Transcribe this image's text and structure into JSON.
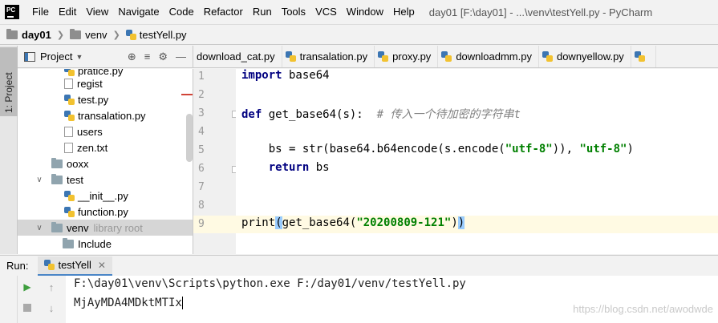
{
  "window": {
    "title": "day01 [F:\\day01] - ...\\venv\\testYell.py - PyCharm",
    "logo_text": "PC"
  },
  "menu": [
    "File",
    "Edit",
    "View",
    "Navigate",
    "Code",
    "Refactor",
    "Run",
    "Tools",
    "VCS",
    "Window",
    "Help"
  ],
  "breadcrumb": {
    "project": "day01",
    "folder": "venv",
    "file": "testYell.py"
  },
  "sidebar": {
    "tab_label": "1: Project"
  },
  "project_panel": {
    "title": "Project",
    "items": [
      {
        "label": "pratice.py",
        "kind": "file"
      },
      {
        "label": "regist",
        "kind": "file"
      },
      {
        "label": "test.py",
        "kind": "file"
      },
      {
        "label": "transalation.py",
        "kind": "file"
      },
      {
        "label": "users",
        "kind": "file"
      },
      {
        "label": "zen.txt",
        "kind": "file"
      },
      {
        "label": "ooxx",
        "kind": "dir"
      },
      {
        "label": "test",
        "kind": "dir"
      },
      {
        "label": "__init__.py",
        "kind": "file"
      },
      {
        "label": "function.py",
        "kind": "file"
      },
      {
        "label": "venv",
        "kind": "dir",
        "hint": "library root"
      },
      {
        "label": "Include",
        "kind": "dir"
      }
    ]
  },
  "editor_tabs": [
    "download_cat.py",
    "transalation.py",
    "proxy.py",
    "downloadmm.py",
    "downyellow.py"
  ],
  "editor": {
    "line_numbers": [
      "1",
      "2",
      "3",
      "4",
      "5",
      "6",
      "7",
      "8",
      "9"
    ],
    "lines": {
      "l1_kw": "import",
      "l1_rest": " base64",
      "l3_kw": "def",
      "l3_rest": " get_base64(s):  ",
      "l3_comment": "# 传入一个待加密的字符串t",
      "l5_pre": "    bs = str(base64.b64encode(s.encode(",
      "l5_str1": "\"utf-8\"",
      "l5_mid": ")), ",
      "l5_str2": "\"utf-8\"",
      "l5_post": ")",
      "l6_pre": "    ",
      "l6_kw": "return",
      "l6_rest": " bs",
      "l9_pre": "print",
      "l9_open": "(",
      "l9_mid": "get_base64(",
      "l9_str": "\"20200809-121\"",
      "l9_mid2": ")",
      "l9_close": ")"
    }
  },
  "run_panel": {
    "label": "Run:",
    "tab": "testYell",
    "output": [
      "F:\\day01\\venv\\Scripts\\python.exe F:/day01/venv/testYell.py",
      "MjAyMDA4MDktMTIx"
    ]
  },
  "watermark": "https://blog.csdn.net/awodwde"
}
